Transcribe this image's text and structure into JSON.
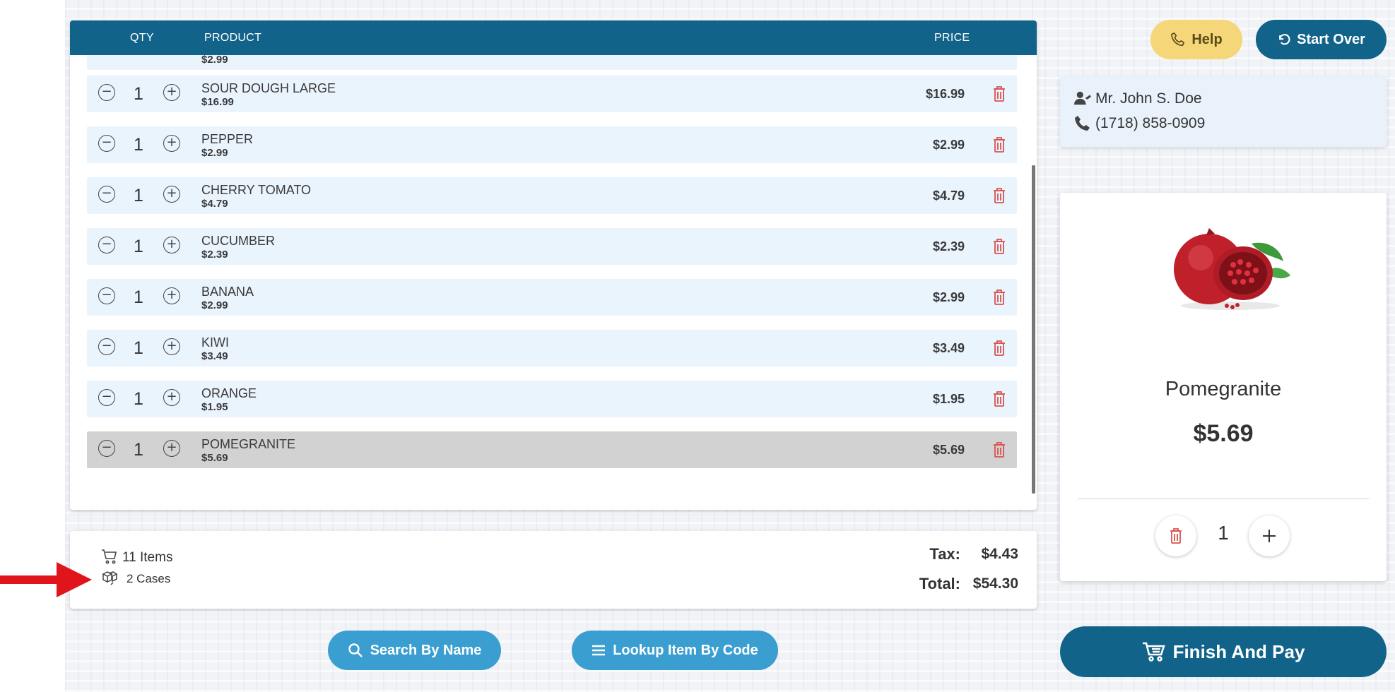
{
  "table": {
    "headers": {
      "qty": "QTY",
      "product": "PRODUCT",
      "price": "PRICE"
    },
    "partial_row": {
      "sub": "$2.99"
    },
    "rows": [
      {
        "qty": "1",
        "name": "SOUR DOUGH LARGE",
        "unit": "$16.99",
        "price": "$16.99",
        "selected": false
      },
      {
        "qty": "1",
        "name": "PEPPER",
        "unit": "$2.99",
        "price": "$2.99",
        "selected": false
      },
      {
        "qty": "1",
        "name": "CHERRY TOMATO",
        "unit": "$4.79",
        "price": "$4.79",
        "selected": false
      },
      {
        "qty": "1",
        "name": "CUCUMBER",
        "unit": "$2.39",
        "price": "$2.39",
        "selected": false
      },
      {
        "qty": "1",
        "name": "BANANA",
        "unit": "$2.99",
        "price": "$2.99",
        "selected": false
      },
      {
        "qty": "1",
        "name": "KIWI",
        "unit": "$3.49",
        "price": "$3.49",
        "selected": false
      },
      {
        "qty": "1",
        "name": "ORANGE",
        "unit": "$1.95",
        "price": "$1.95",
        "selected": false
      },
      {
        "qty": "1",
        "name": "POMEGRANITE",
        "unit": "$5.69",
        "price": "$5.69",
        "selected": true
      }
    ]
  },
  "summary": {
    "items": "11 Items",
    "cases": "2 Cases",
    "tax_label": "Tax:",
    "tax_value": "$4.43",
    "total_label": "Total:",
    "total_value": "$54.30"
  },
  "actions": {
    "search_by_name": "Search By Name",
    "lookup_by_code": "Lookup Item By Code",
    "help": "Help",
    "start_over": "Start Over",
    "finish_and_pay": "Finish And Pay"
  },
  "customer": {
    "name": "Mr. John S. Doe",
    "phone": "(1718) 858-0909"
  },
  "selected_product": {
    "name": "Pomegranite",
    "price": "$5.69",
    "qty": "1"
  },
  "colors": {
    "header": "#12638a",
    "row": "#eaf4fd",
    "selected_row": "#d2d2d2",
    "pill": "#3a9fd0",
    "help": "#f5d77a",
    "trash": "#d9534f",
    "arrow": "#e0151b"
  }
}
